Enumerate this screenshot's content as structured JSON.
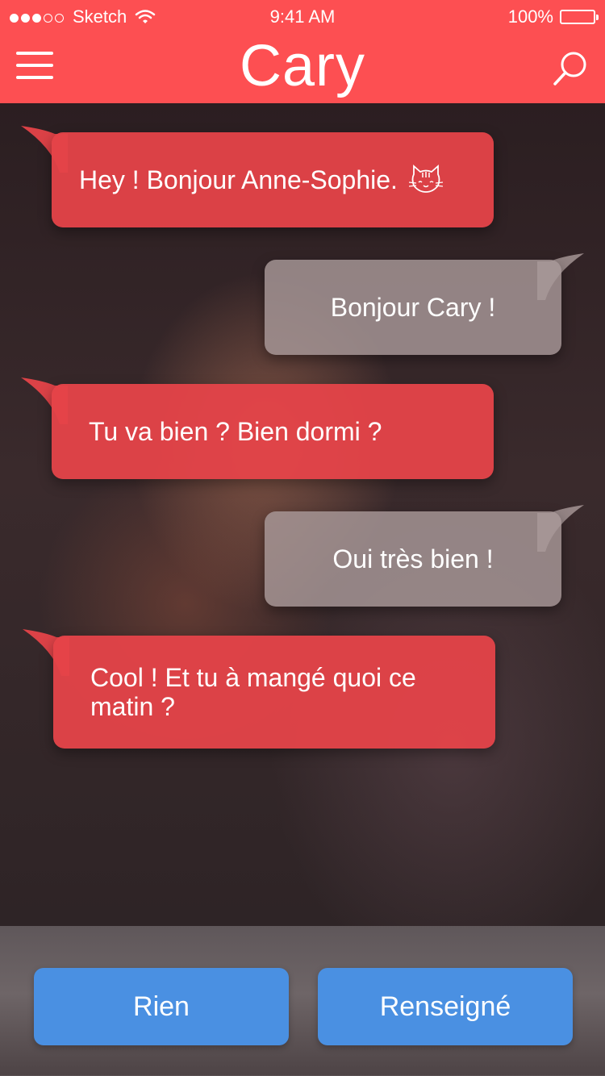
{
  "status_bar": {
    "carrier": "Sketch",
    "time": "9:41 AM",
    "battery": "100%"
  },
  "header": {
    "title": "Cary",
    "menu_icon": "hamburger-menu-icon",
    "search_icon": "search-icon"
  },
  "messages": [
    {
      "sender": "bot",
      "text": "Hey ! Bonjour Anne-Sophie.",
      "emoji": "cat-face-icon"
    },
    {
      "sender": "user",
      "text": "Bonjour Cary !"
    },
    {
      "sender": "bot",
      "text": "Tu va bien ? Bien dormi ?"
    },
    {
      "sender": "user",
      "text": "Oui très bien !"
    },
    {
      "sender": "bot",
      "text": "Cool ! Et tu à mangé quoi ce matin ?"
    }
  ],
  "replies": {
    "option_1": "Rien",
    "option_2": "Renseigné"
  },
  "colors": {
    "brand": "#fd4f52",
    "bot_bubble": "#e54349",
    "user_bubble": "#a89898",
    "reply_button": "#4a90e2"
  }
}
